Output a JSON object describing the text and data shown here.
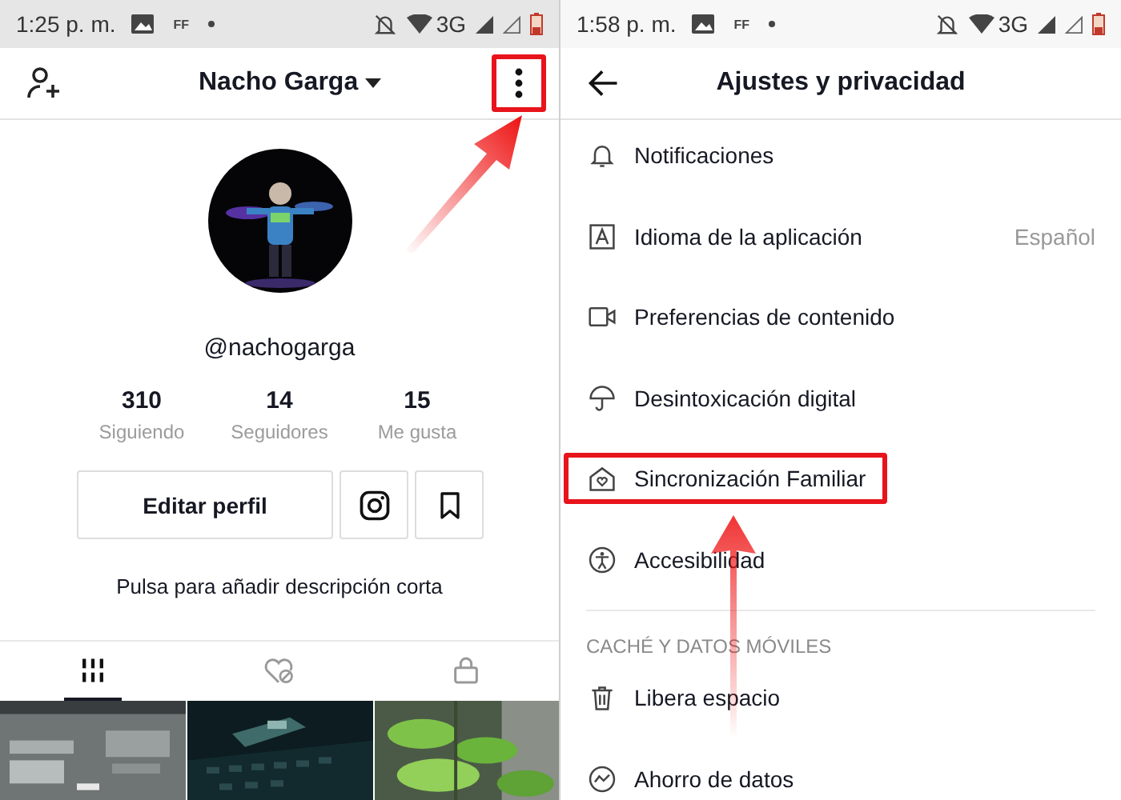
{
  "profile_screen": {
    "status_bar": {
      "time": "1:25 p. m.",
      "badge": "FF",
      "network": "3G"
    },
    "header": {
      "title": "Nacho Garga",
      "menu_highlighted": true
    },
    "username": "@nachogarga",
    "stats": [
      {
        "value": "310",
        "label": "Siguiendo"
      },
      {
        "value": "14",
        "label": "Seguidores"
      },
      {
        "value": "15",
        "label": "Me gusta"
      }
    ],
    "edit_button": "Editar perfil",
    "bio_prompt": "Pulsa para añadir descripción corta",
    "tabs": [
      {
        "selected": true
      },
      {
        "selected": false
      },
      {
        "selected": false
      }
    ]
  },
  "settings_screen": {
    "status_bar": {
      "time": "1:58 p. m.",
      "badge": "FF",
      "network": "3G"
    },
    "title": "Ajustes y privacidad",
    "items": [
      {
        "kind": "row",
        "label": "Notificaciones",
        "highlighted": false
      },
      {
        "kind": "row",
        "label": "Idioma de la aplicación",
        "value": "Español",
        "highlighted": false
      },
      {
        "kind": "row",
        "label": "Preferencias de contenido",
        "highlighted": false
      },
      {
        "kind": "row",
        "label": "Desintoxicación digital",
        "highlighted": false
      },
      {
        "kind": "row",
        "label": "Sincronización Familiar",
        "highlighted": true
      },
      {
        "kind": "row",
        "label": "Accesibilidad",
        "highlighted": false
      },
      {
        "kind": "section",
        "label": "CACHÉ Y DATOS MÓVILES"
      },
      {
        "kind": "row",
        "label": "Libera espacio",
        "highlighted": false
      },
      {
        "kind": "row",
        "label": "Ahorro de datos",
        "highlighted": false
      }
    ]
  }
}
